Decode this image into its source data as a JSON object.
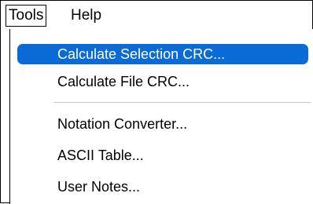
{
  "menubar": {
    "items": [
      {
        "label": "Tools"
      },
      {
        "label": "Help"
      }
    ]
  },
  "tools_menu": {
    "items": [
      {
        "label": "Calculate Selection CRC...",
        "highlighted": true
      },
      {
        "label": "Calculate File CRC..."
      },
      {
        "label": "Notation Converter..."
      },
      {
        "label": "ASCII Table..."
      },
      {
        "label": "User Notes..."
      }
    ]
  },
  "colors": {
    "highlight": "#0a6bd6",
    "separator": "#cccccc",
    "border": "#000000"
  }
}
